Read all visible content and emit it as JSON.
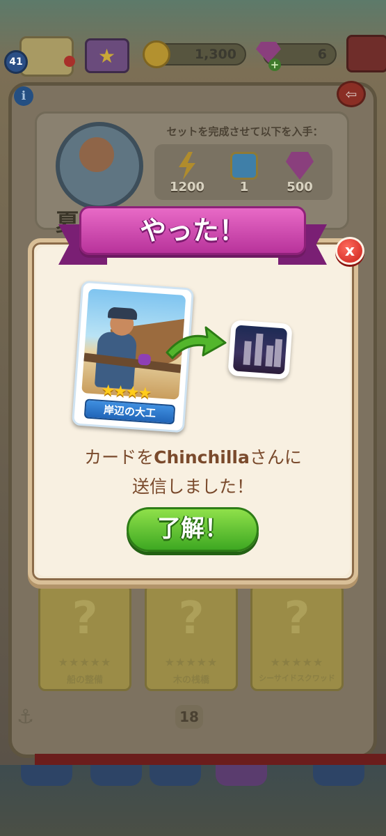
{
  "topbar": {
    "level": "41",
    "coins": "1,300",
    "gems": "6",
    "gem_plus": "+"
  },
  "set_panel": {
    "reward_title": "セットを完成させて以下を入手：",
    "rewards": [
      {
        "name": "lightning-energy",
        "value": "1200",
        "color": "#b08c2c"
      },
      {
        "name": "treasure-chest",
        "value": "1",
        "color": "#3f7fa8"
      },
      {
        "name": "purple-gem",
        "value": "500",
        "color": "#8a3f7d"
      }
    ],
    "title_fragment": "夏"
  },
  "slots": [
    {
      "question": "?",
      "stars": "★★★★★",
      "name": "船の整備"
    },
    {
      "question": "?",
      "stars": "★★★★★",
      "name": "木の桟橋"
    },
    {
      "question": "?",
      "stars": "★★★★★",
      "name": "シーサイドスクワッド"
    }
  ],
  "page_number": "18",
  "dialog": {
    "ribbon_title": "やった！",
    "close_label": "x",
    "card": {
      "stars": "★★★★",
      "name": "岸辺の大工"
    },
    "message_prefix": "カードを",
    "message_player": "Chinchilla",
    "message_suffix": "さんに",
    "message_line2": "送信しました！",
    "ok_label": "了解！"
  },
  "colors": {
    "ribbon": "#d24fb5",
    "ok_button": "#4cb827",
    "close_button": "#d9281f",
    "card_label": "#2f7ad0",
    "message_text": "#7a4a2c"
  }
}
